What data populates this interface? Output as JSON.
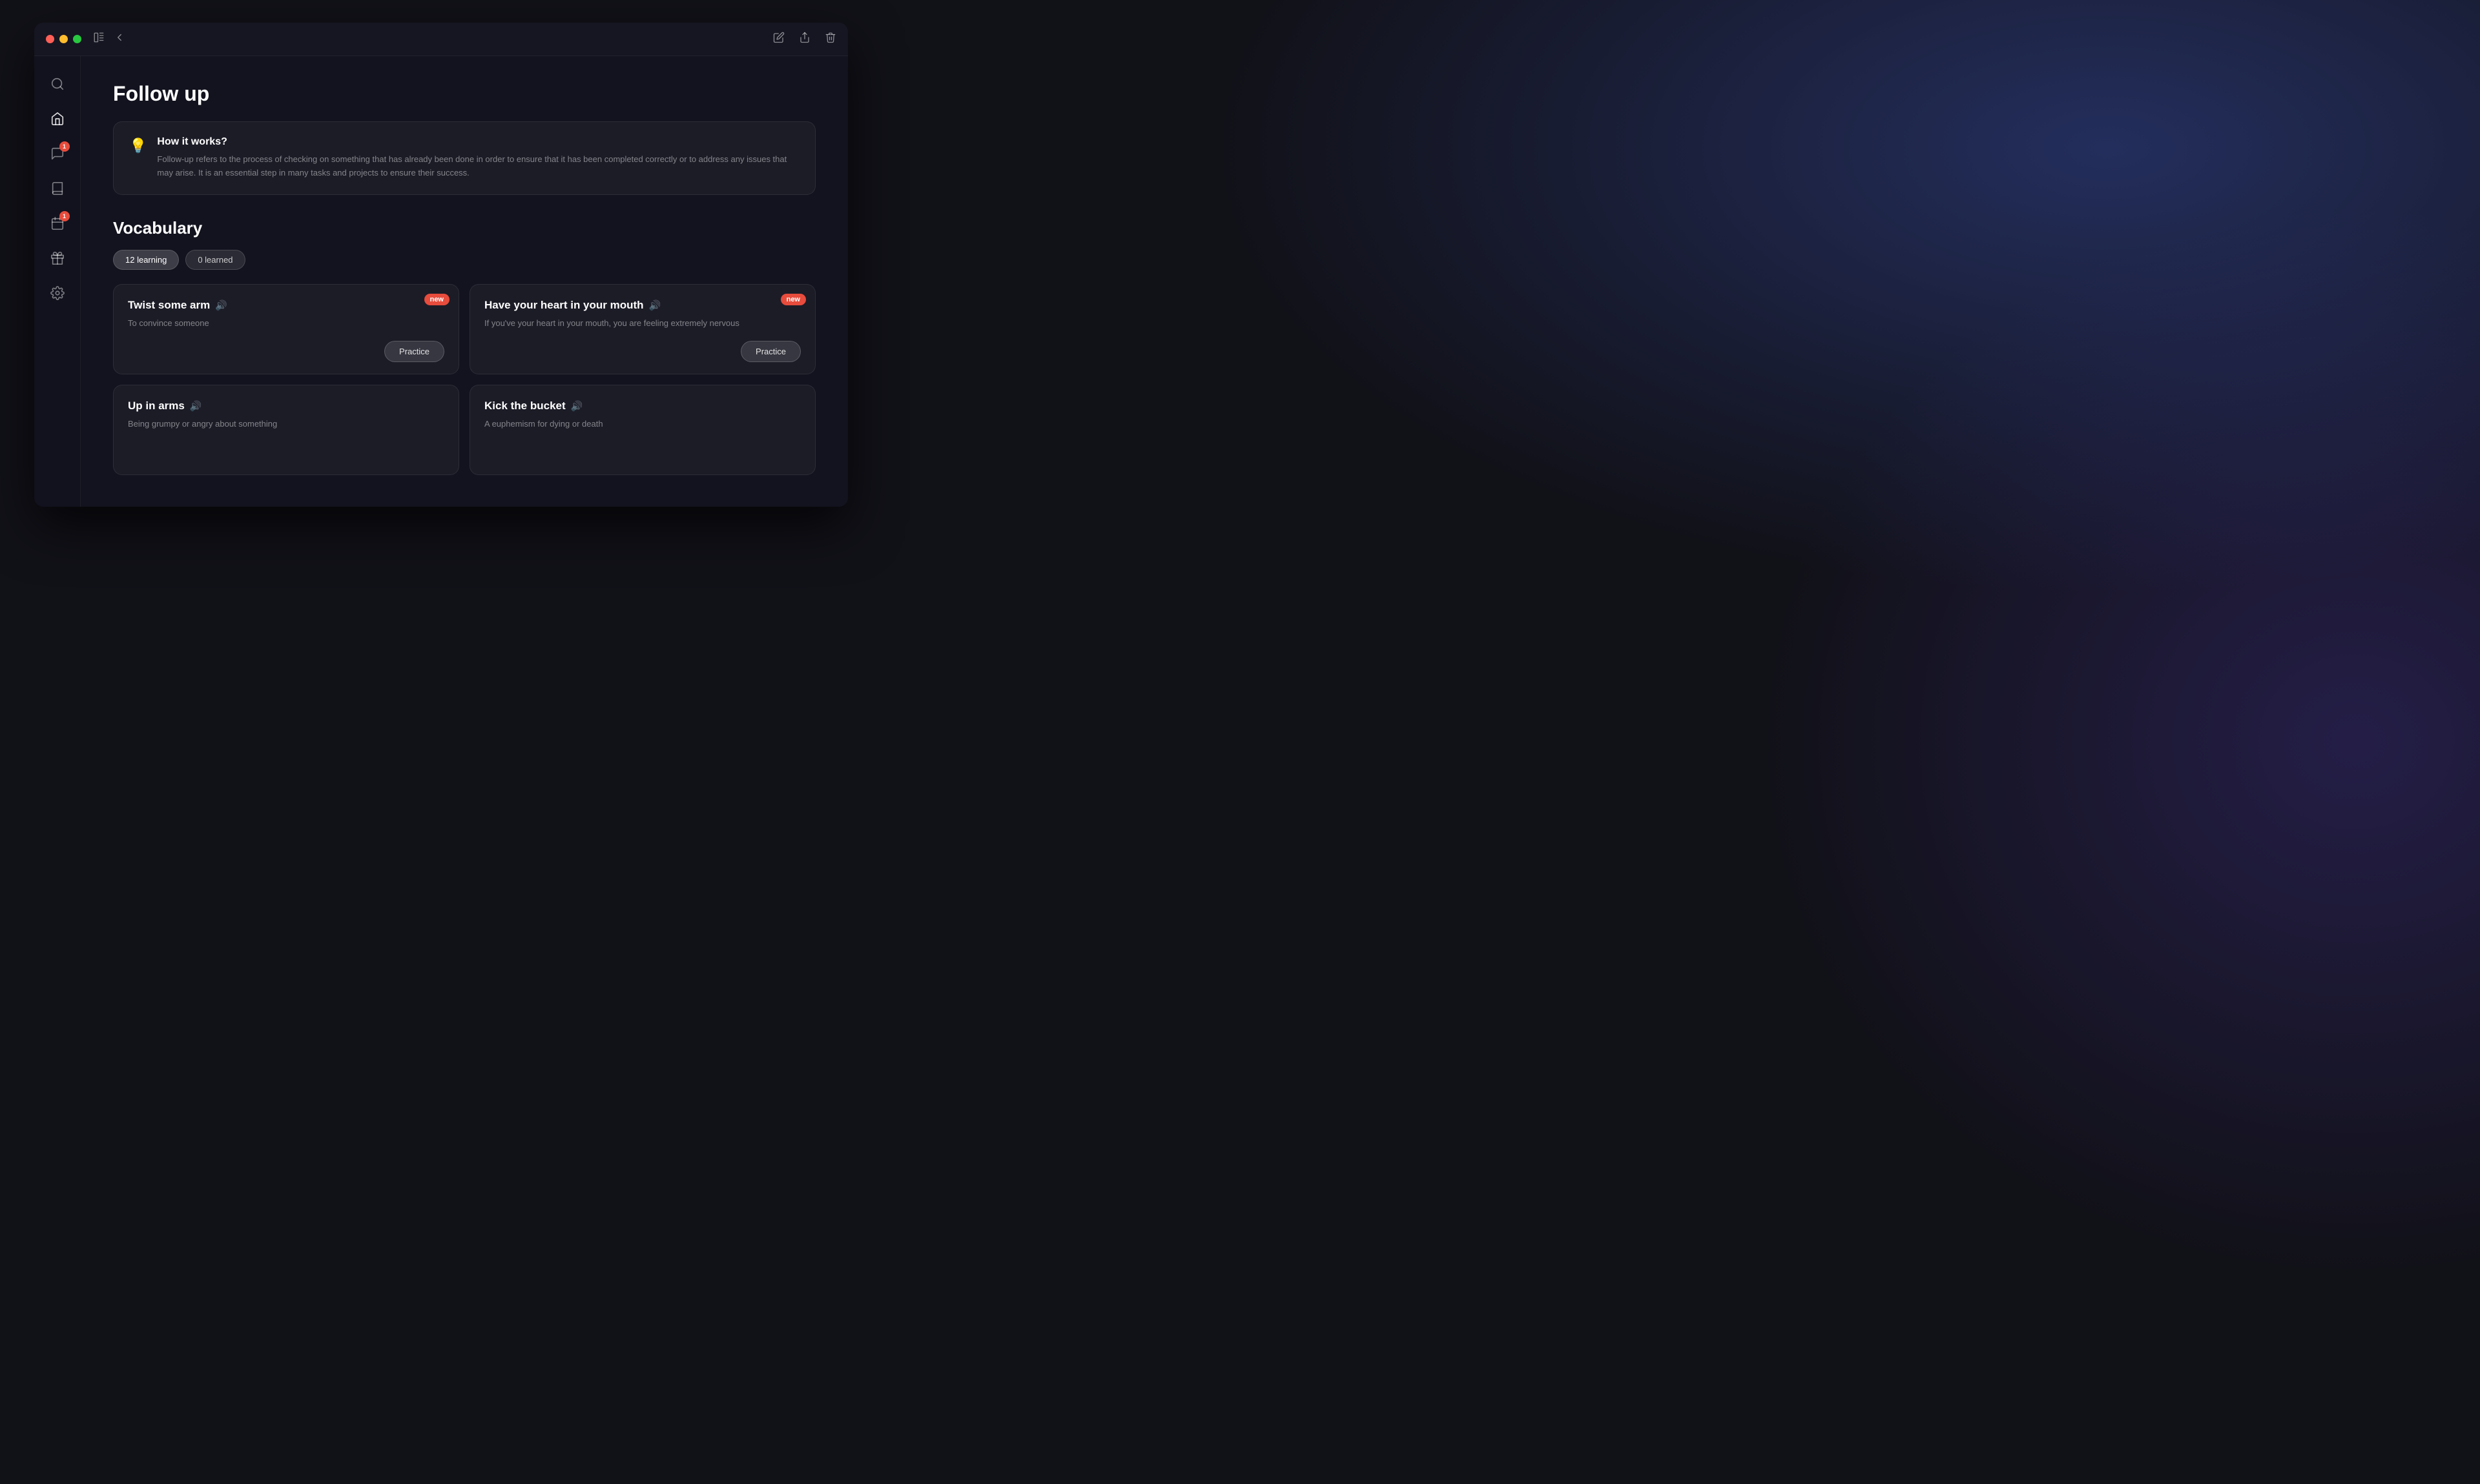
{
  "app": {
    "title": "Follow up"
  },
  "titlebar": {
    "traffic_lights": [
      "red",
      "yellow",
      "green"
    ],
    "back_label": "‹",
    "edit_icon": "pencil",
    "share_icon": "share",
    "delete_icon": "trash"
  },
  "sidebar": {
    "items": [
      {
        "id": "search",
        "icon": "search",
        "badge": null,
        "label": "Search"
      },
      {
        "id": "home",
        "icon": "home",
        "badge": null,
        "label": "Home"
      },
      {
        "id": "messages",
        "icon": "messages",
        "badge": 1,
        "label": "Messages"
      },
      {
        "id": "library",
        "icon": "book",
        "badge": null,
        "label": "Library"
      },
      {
        "id": "calendar",
        "icon": "calendar",
        "badge": 1,
        "label": "Calendar"
      },
      {
        "id": "gifts",
        "icon": "gift",
        "badge": null,
        "label": "Gifts"
      },
      {
        "id": "settings",
        "icon": "settings",
        "badge": null,
        "label": "Settings"
      }
    ]
  },
  "page": {
    "title": "Follow up",
    "info_card": {
      "icon": "💡",
      "title": "How it works?",
      "description": "Follow-up refers to the process of checking on something that has already been done in order to ensure that it has been completed correctly or to address any issues that may arise. It is an essential step in many tasks and projects to ensure their success."
    },
    "vocabulary": {
      "section_title": "Vocabulary",
      "filters": [
        {
          "label": "12 learning",
          "active": true
        },
        {
          "label": "0 learned",
          "active": false
        }
      ],
      "cards": [
        {
          "phrase": "Twist some arm",
          "sound": true,
          "is_new": true,
          "meaning": "To convince someone",
          "has_practice": true,
          "practice_label": "Practice"
        },
        {
          "phrase": "Have your heart in your mouth",
          "sound": true,
          "is_new": true,
          "meaning": "If you've your heart in your mouth, you are feeling extremely nervous",
          "has_practice": true,
          "practice_label": "Practice"
        },
        {
          "phrase": "Up in arms",
          "sound": true,
          "is_new": false,
          "meaning": "Being grumpy or angry about something",
          "has_practice": false,
          "practice_label": ""
        },
        {
          "phrase": "Kick the bucket",
          "sound": true,
          "is_new": false,
          "meaning": "A euphemism for dying or death",
          "has_practice": false,
          "practice_label": ""
        }
      ]
    }
  }
}
